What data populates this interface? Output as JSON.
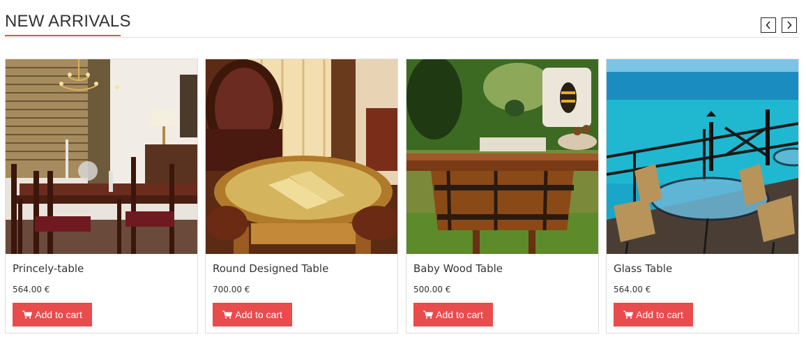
{
  "section": {
    "title": "NEW ARRIVALS",
    "accent_color": "#e84c4c"
  },
  "nav": {
    "prev_icon": "chevron-left-icon",
    "next_icon": "chevron-right-icon"
  },
  "products": [
    {
      "name": "Princely-table",
      "price": "564.00 €",
      "cta": "Add to cart",
      "icon": "shopping-cart-icon"
    },
    {
      "name": "Round Designed Table",
      "price": "700.00 €",
      "cta": "Add to cart",
      "icon": "shopping-cart-icon"
    },
    {
      "name": "Baby Wood Table",
      "price": "500.00 €",
      "cta": "Add to cart",
      "icon": "shopping-cart-icon"
    },
    {
      "name": "Glass Table",
      "price": "564.00 €",
      "cta": "Add to cart",
      "icon": "shopping-cart-icon"
    }
  ]
}
